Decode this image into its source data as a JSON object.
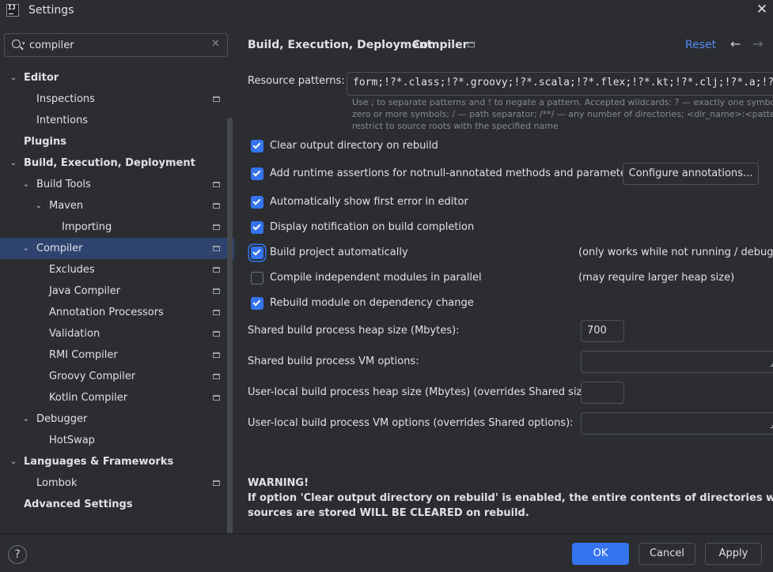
{
  "window": {
    "title": "Settings",
    "app_icon_text": "IJ"
  },
  "search": {
    "value": "compiler",
    "clear_glyph": "✕"
  },
  "tree": [
    {
      "label": "Editor",
      "bold": true,
      "chevron": "down"
    },
    {
      "label": "Inspections",
      "proj": true
    },
    {
      "label": "Intentions"
    },
    {
      "label": "Plugins",
      "bold": true
    },
    {
      "label": "Build, Execution, Deployment",
      "bold": true,
      "chevron": "down"
    },
    {
      "label": "Build Tools",
      "chevron": "down",
      "proj": true
    },
    {
      "label": "Maven",
      "chevron": "down",
      "proj": true
    },
    {
      "label": "Importing",
      "proj": true
    },
    {
      "label": "Compiler",
      "chevron": "down",
      "proj": true,
      "selected": true
    },
    {
      "label": "Excludes",
      "proj": true
    },
    {
      "label": "Java Compiler",
      "proj": true
    },
    {
      "label": "Annotation Processors",
      "proj": true
    },
    {
      "label": "Validation",
      "proj": true
    },
    {
      "label": "RMI Compiler",
      "proj": true
    },
    {
      "label": "Groovy Compiler",
      "proj": true
    },
    {
      "label": "Kotlin Compiler",
      "proj": true
    },
    {
      "label": "Debugger",
      "chevron": "down"
    },
    {
      "label": "HotSwap"
    },
    {
      "label": "Languages & Frameworks",
      "bold": true,
      "chevron": "down"
    },
    {
      "label": "Lombok",
      "proj": true
    },
    {
      "label": "Advanced Settings",
      "bold": true
    }
  ],
  "header": {
    "crumb_parent": "Build, Execution, Deployment",
    "crumb_sep": "›",
    "crumb_current": "Compiler",
    "reset": "Reset",
    "back_glyph": "←",
    "forward_glyph": "→"
  },
  "resource": {
    "label": "Resource patterns:",
    "value": "form;!?*.class;!?*.groovy;!?*.scala;!?*.flex;!?*.kt;!?*.clj;!?*.a;!?*.aj",
    "hint1": "Use ; to separate patterns and ! to negate a pattern. Accepted wildcards: ? — exactly one symbol; * —",
    "hint2": "zero or more symbols; / — path separator; /**/ — any number of directories; <dir_name>:<pattern> —",
    "hint3": "restrict to source roots with the specified name"
  },
  "options": [
    {
      "label": "Clear output directory on rebuild",
      "checked": true
    },
    {
      "label": "Add runtime assertions for notnull-annotated methods and parameters",
      "checked": true
    },
    {
      "label": "Automatically show first error in editor",
      "checked": true
    },
    {
      "label": "Display notification on build completion",
      "checked": true
    },
    {
      "label": "Build project automatically",
      "checked": true,
      "note": "(only works while not running / debugging)"
    },
    {
      "label": "Compile independent modules in parallel",
      "checked": false,
      "note": "(may require larger heap size)"
    },
    {
      "label": "Rebuild module on dependency change",
      "checked": true
    }
  ],
  "configure_annotations": "Configure annotations...",
  "heap": {
    "label": "Shared build process heap size (Mbytes):",
    "value": "700"
  },
  "vm": {
    "label": "Shared build process VM options:",
    "value": ""
  },
  "local_heap": {
    "label": "User-local build process heap size (Mbytes) (overrides Shared size):",
    "value": ""
  },
  "local_vm": {
    "label": "User-local build process VM options (overrides Shared options):",
    "value": ""
  },
  "warning": {
    "title": "WARNING!",
    "line1": "If option 'Clear output directory on rebuild' is enabled, the entire contents of directories where generated",
    "line2": "sources are stored WILL BE CLEARED on rebuild."
  },
  "footer": {
    "help": "?",
    "ok": "OK",
    "cancel": "Cancel",
    "apply": "Apply"
  },
  "colors": {
    "accent": "#3574f0",
    "selection": "#2e436e",
    "link": "#548af7",
    "background": "#2b2d30"
  }
}
